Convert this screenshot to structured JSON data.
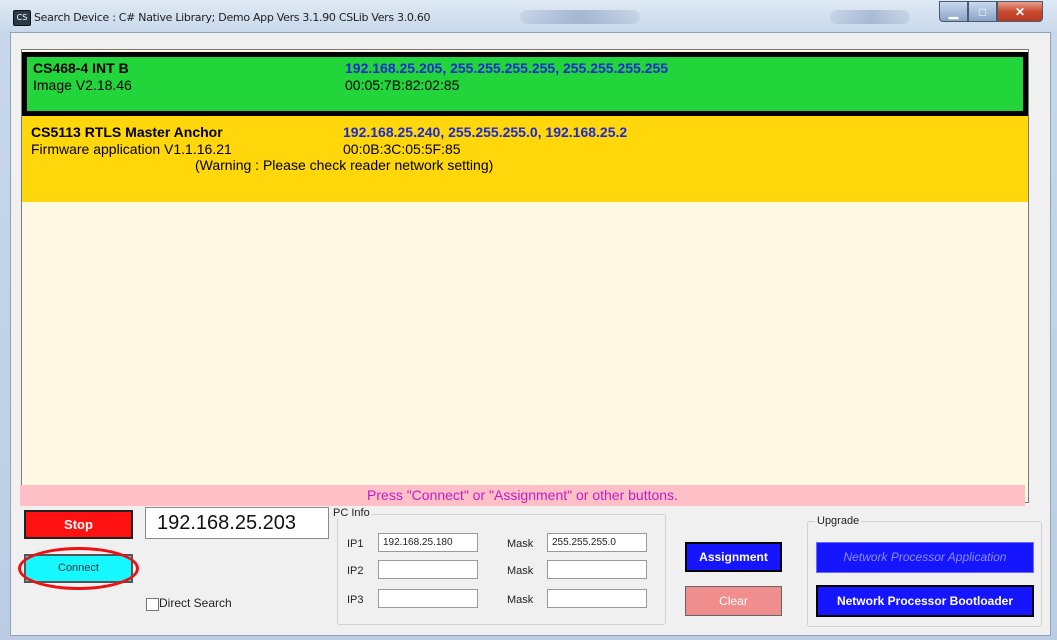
{
  "window": {
    "title": "Search Device : C# Native Library; Demo App Vers 3.1.90 CSLib Vers 3.0.60",
    "app_icon": "CS"
  },
  "devices": [
    {
      "name": "CS468-4 INT B",
      "subtitle": "Image V2.18.46",
      "network": "192.168.25.205, 255.255.255.255, 255.255.255.255",
      "mac": "00:05:7B:82:02:85",
      "bg_color": "#22d53a",
      "selected": true
    },
    {
      "name": "CS5113 RTLS Master Anchor",
      "subtitle": "Firmware application V1.1.16.21",
      "network": "192.168.25.240, 255.255.255.0, 192.168.25.2",
      "mac": "00:0B:3C:05:5F:85",
      "warning": "(Warning : Please check reader network setting)",
      "bg_color": "#ffd70a"
    }
  ],
  "status_message": "Press \"Connect\" or \"Assignment\" or other buttons.",
  "controls": {
    "stop_label": "Stop",
    "connect_label": "Connect",
    "ip_address": "192.168.25.203",
    "direct_search_label": "Direct Search",
    "direct_search_checked": false
  },
  "pc_info": {
    "title": "PC Info",
    "rows": [
      {
        "ip_label": "IP1",
        "ip_value": "192.168.25.180",
        "mask_label": "Mask",
        "mask_value": "255.255.255.0"
      },
      {
        "ip_label": "IP2",
        "ip_value": "",
        "mask_label": "Mask",
        "mask_value": ""
      },
      {
        "ip_label": "IP3",
        "ip_value": "",
        "mask_label": "Mask",
        "mask_value": ""
      }
    ]
  },
  "actions": {
    "assignment_label": "Assignment",
    "clear_label": "Clear"
  },
  "upgrade": {
    "title": "Upgrade",
    "np_application_label": "Network Processor Application",
    "np_bootloader_label": "Network Processor Bootloader"
  },
  "colors": {
    "stop_button": "#ff1111",
    "connect_button": "#15f8ff",
    "assignment_button": "#1515ff",
    "clear_button": "#f08e8e",
    "highlight_ring": "#ee1010",
    "status_text": "#c41cc4"
  }
}
